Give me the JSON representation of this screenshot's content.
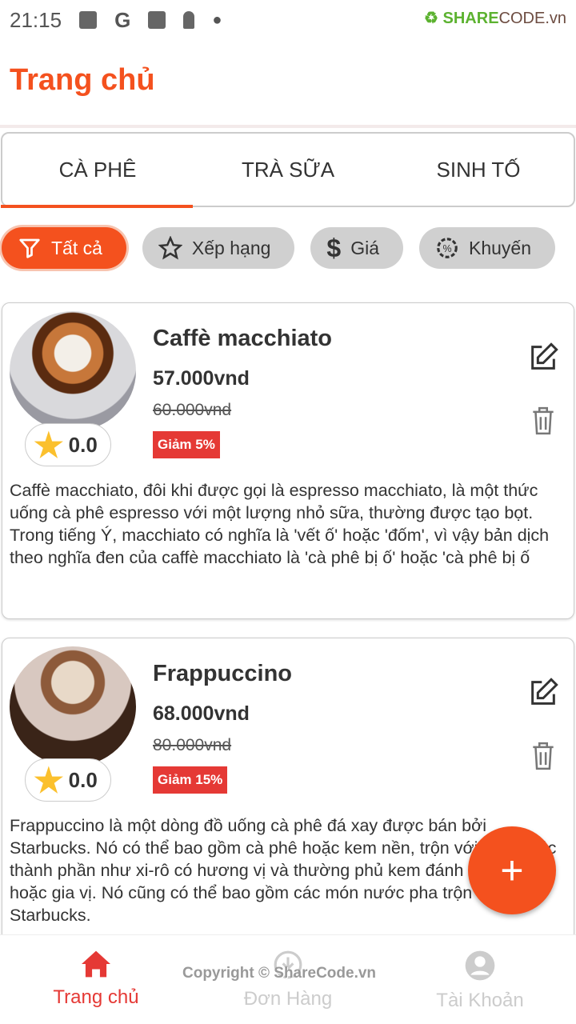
{
  "status": {
    "time": "21:15",
    "watermark_logo": "SHARECODE.vn"
  },
  "header": {
    "title": "Trang chủ"
  },
  "tabs": [
    {
      "label": "CÀ PHÊ"
    },
    {
      "label": "TRÀ SỮA"
    },
    {
      "label": "SINH TỐ"
    }
  ],
  "filters": [
    {
      "label": "Tất cả",
      "icon": "filter-icon"
    },
    {
      "label": "Xếp hạng",
      "icon": "star-icon"
    },
    {
      "label": "Giá",
      "icon": "dollar-icon"
    },
    {
      "label": "Khuyến",
      "icon": "discount-icon"
    }
  ],
  "products": [
    {
      "name": "Caffè macchiato",
      "price": "57.000vnd",
      "old_price": "60.000vnd",
      "discount": "Giảm 5%",
      "rating": "0.0",
      "description": "Caffè macchiato, đôi khi được gọi là espresso macchiato, là một thức uống cà phê espresso với một lượng nhỏ sữa, thường được tạo bọt. Trong tiếng Ý, macchiato có nghĩa là 'vết ố' hoặc 'đốm', vì vậy bản dịch theo nghĩa đen của caffè macchiato là 'cà phê bị ố' hoặc 'cà phê bị ố"
    },
    {
      "name": "Frappuccino",
      "price": "68.000vnd",
      "old_price": "80.000vnd",
      "discount": "Giảm 15%",
      "rating": "0.0",
      "description": "Frappuccino là một dòng đồ uống cà phê đá xay được bán bởi Starbucks. Nó có thể bao gồm cà phê hoặc kem nền, trộn với đá và các thành phần như xi-rô có hương vị và thường phủ kem đánh bông và hoặc gia vị. Nó cũng có thể bao gồm các món nước pha trộn của Starbucks."
    }
  ],
  "fab": {
    "label": "+"
  },
  "nav": [
    {
      "label": "Trang chủ",
      "icon": "home-icon"
    },
    {
      "label": "Đơn Hàng",
      "icon": "download-icon"
    },
    {
      "label": "Tài Khoản",
      "icon": "account-icon"
    }
  ],
  "watermark": {
    "copyright": "Copyright © ShareCode.vn"
  },
  "colors": {
    "accent": "#f4511e",
    "discount": "#e53935"
  }
}
